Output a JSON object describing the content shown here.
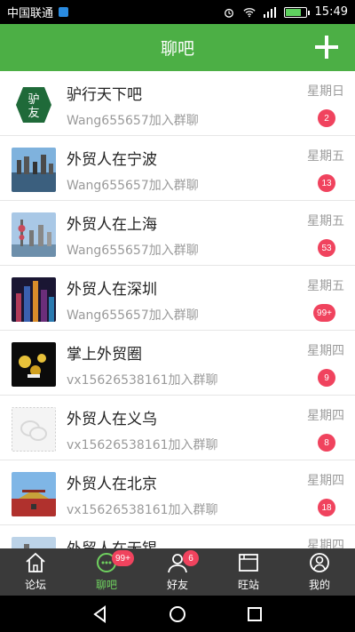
{
  "status": {
    "carrier": "中国联通",
    "time": "15:49"
  },
  "header": {
    "title": "聊吧"
  },
  "chats": [
    {
      "name": "驴行天下吧",
      "sub": "Wang655657加入群聊",
      "day": "星期日",
      "badge": "2"
    },
    {
      "name": "外贸人在宁波",
      "sub": "Wang655657加入群聊",
      "day": "星期五",
      "badge": "13"
    },
    {
      "name": "外贸人在上海",
      "sub": "Wang655657加入群聊",
      "day": "星期五",
      "badge": "53"
    },
    {
      "name": "外贸人在深圳",
      "sub": "Wang655657加入群聊",
      "day": "星期五",
      "badge": "99+"
    },
    {
      "name": "掌上外贸圈",
      "sub": "vx15626538161加入群聊",
      "day": "星期四",
      "badge": "9"
    },
    {
      "name": "外贸人在义乌",
      "sub": "vx15626538161加入群聊",
      "day": "星期四",
      "badge": "8"
    },
    {
      "name": "外贸人在北京",
      "sub": "vx15626538161加入群聊",
      "day": "星期四",
      "badge": "18"
    },
    {
      "name": "外贸人在无锡",
      "sub": "",
      "day": "星期四",
      "badge": ""
    }
  ],
  "tabs": [
    {
      "label": "论坛",
      "badge": ""
    },
    {
      "label": "聊吧",
      "badge": "99+"
    },
    {
      "label": "好友",
      "badge": "6"
    },
    {
      "label": "旺站",
      "badge": ""
    },
    {
      "label": "我的",
      "badge": ""
    }
  ],
  "colors": {
    "accent": "#4caf45",
    "badge": "#f0435e",
    "tabbar": "#3a3a3a",
    "active_tab": "#6fd05f"
  }
}
